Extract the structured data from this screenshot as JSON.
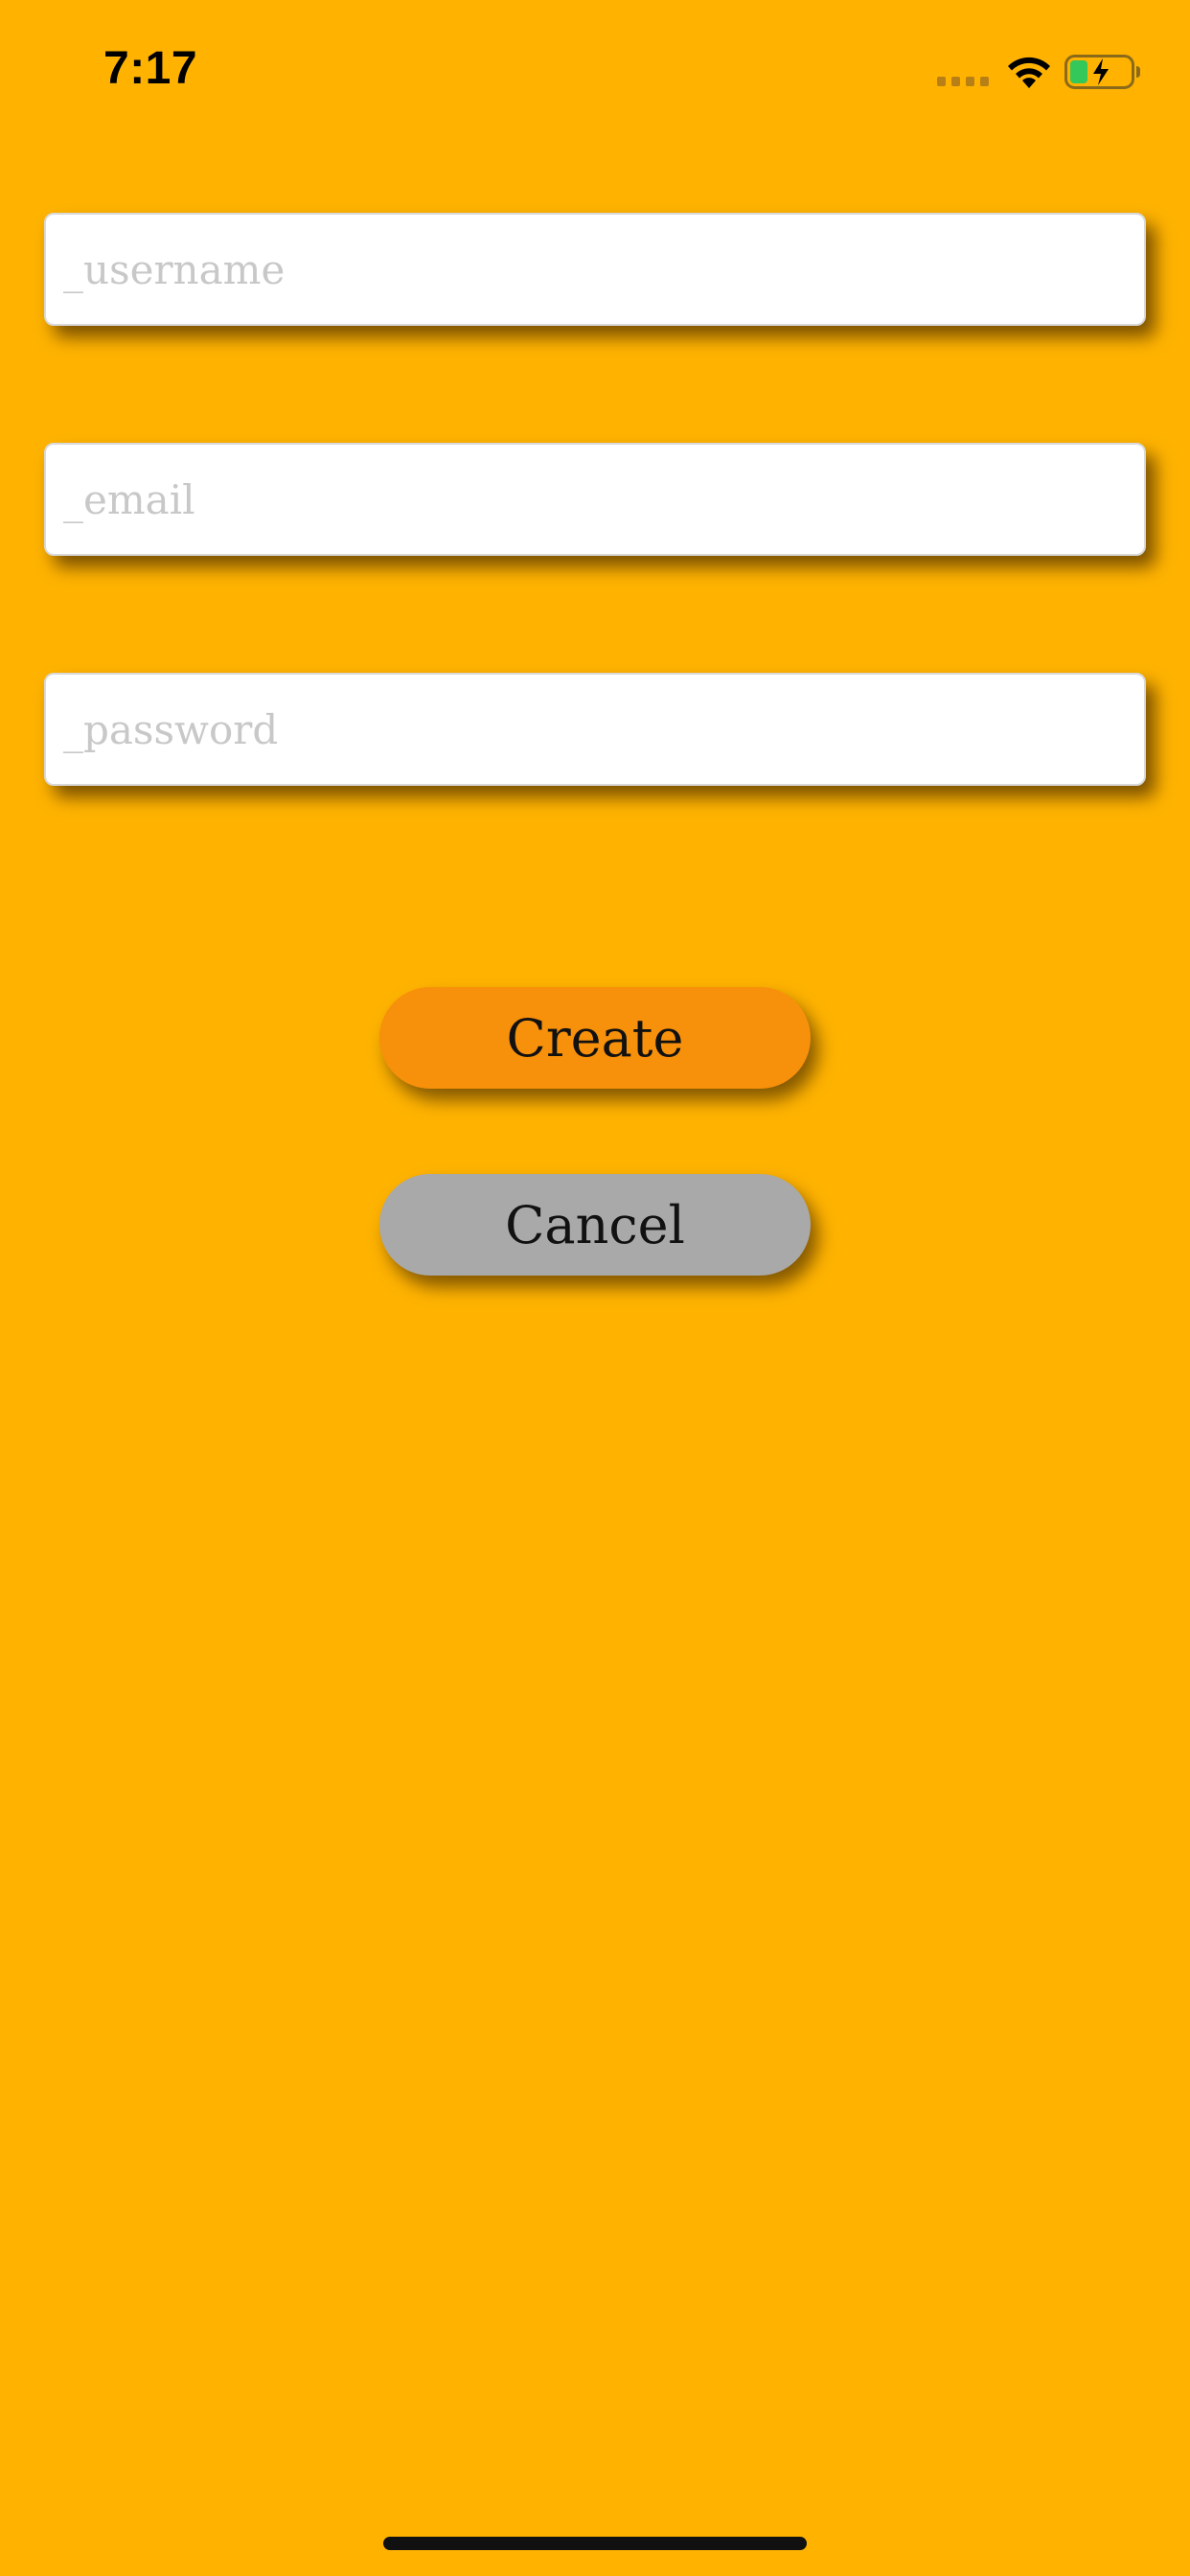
{
  "status_bar": {
    "time": "7:17",
    "icons": [
      "signal-icon",
      "wifi-icon",
      "battery-charging-icon"
    ]
  },
  "form": {
    "username": {
      "value": "",
      "placeholder": "_username"
    },
    "email": {
      "value": "",
      "placeholder": "_email"
    },
    "password": {
      "value": "",
      "placeholder": "_password"
    }
  },
  "buttons": {
    "create_label": "Create",
    "cancel_label": "Cancel"
  },
  "colors": {
    "background": "#FFB300",
    "create_button": "#F7900A",
    "cancel_button": "#A9A9A9",
    "battery_fill": "#34C759"
  }
}
